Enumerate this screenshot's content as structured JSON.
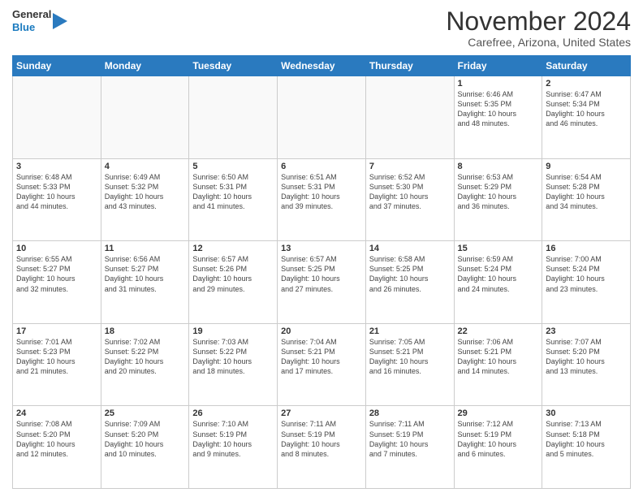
{
  "logo": {
    "line1": "General",
    "line2": "Blue"
  },
  "title": "November 2024",
  "location": "Carefree, Arizona, United States",
  "weekdays": [
    "Sunday",
    "Monday",
    "Tuesday",
    "Wednesday",
    "Thursday",
    "Friday",
    "Saturday"
  ],
  "weeks": [
    [
      {
        "day": "",
        "info": ""
      },
      {
        "day": "",
        "info": ""
      },
      {
        "day": "",
        "info": ""
      },
      {
        "day": "",
        "info": ""
      },
      {
        "day": "",
        "info": ""
      },
      {
        "day": "1",
        "info": "Sunrise: 6:46 AM\nSunset: 5:35 PM\nDaylight: 10 hours\nand 48 minutes."
      },
      {
        "day": "2",
        "info": "Sunrise: 6:47 AM\nSunset: 5:34 PM\nDaylight: 10 hours\nand 46 minutes."
      }
    ],
    [
      {
        "day": "3",
        "info": "Sunrise: 6:48 AM\nSunset: 5:33 PM\nDaylight: 10 hours\nand 44 minutes."
      },
      {
        "day": "4",
        "info": "Sunrise: 6:49 AM\nSunset: 5:32 PM\nDaylight: 10 hours\nand 43 minutes."
      },
      {
        "day": "5",
        "info": "Sunrise: 6:50 AM\nSunset: 5:31 PM\nDaylight: 10 hours\nand 41 minutes."
      },
      {
        "day": "6",
        "info": "Sunrise: 6:51 AM\nSunset: 5:31 PM\nDaylight: 10 hours\nand 39 minutes."
      },
      {
        "day": "7",
        "info": "Sunrise: 6:52 AM\nSunset: 5:30 PM\nDaylight: 10 hours\nand 37 minutes."
      },
      {
        "day": "8",
        "info": "Sunrise: 6:53 AM\nSunset: 5:29 PM\nDaylight: 10 hours\nand 36 minutes."
      },
      {
        "day": "9",
        "info": "Sunrise: 6:54 AM\nSunset: 5:28 PM\nDaylight: 10 hours\nand 34 minutes."
      }
    ],
    [
      {
        "day": "10",
        "info": "Sunrise: 6:55 AM\nSunset: 5:27 PM\nDaylight: 10 hours\nand 32 minutes."
      },
      {
        "day": "11",
        "info": "Sunrise: 6:56 AM\nSunset: 5:27 PM\nDaylight: 10 hours\nand 31 minutes."
      },
      {
        "day": "12",
        "info": "Sunrise: 6:57 AM\nSunset: 5:26 PM\nDaylight: 10 hours\nand 29 minutes."
      },
      {
        "day": "13",
        "info": "Sunrise: 6:57 AM\nSunset: 5:25 PM\nDaylight: 10 hours\nand 27 minutes."
      },
      {
        "day": "14",
        "info": "Sunrise: 6:58 AM\nSunset: 5:25 PM\nDaylight: 10 hours\nand 26 minutes."
      },
      {
        "day": "15",
        "info": "Sunrise: 6:59 AM\nSunset: 5:24 PM\nDaylight: 10 hours\nand 24 minutes."
      },
      {
        "day": "16",
        "info": "Sunrise: 7:00 AM\nSunset: 5:24 PM\nDaylight: 10 hours\nand 23 minutes."
      }
    ],
    [
      {
        "day": "17",
        "info": "Sunrise: 7:01 AM\nSunset: 5:23 PM\nDaylight: 10 hours\nand 21 minutes."
      },
      {
        "day": "18",
        "info": "Sunrise: 7:02 AM\nSunset: 5:22 PM\nDaylight: 10 hours\nand 20 minutes."
      },
      {
        "day": "19",
        "info": "Sunrise: 7:03 AM\nSunset: 5:22 PM\nDaylight: 10 hours\nand 18 minutes."
      },
      {
        "day": "20",
        "info": "Sunrise: 7:04 AM\nSunset: 5:21 PM\nDaylight: 10 hours\nand 17 minutes."
      },
      {
        "day": "21",
        "info": "Sunrise: 7:05 AM\nSunset: 5:21 PM\nDaylight: 10 hours\nand 16 minutes."
      },
      {
        "day": "22",
        "info": "Sunrise: 7:06 AM\nSunset: 5:21 PM\nDaylight: 10 hours\nand 14 minutes."
      },
      {
        "day": "23",
        "info": "Sunrise: 7:07 AM\nSunset: 5:20 PM\nDaylight: 10 hours\nand 13 minutes."
      }
    ],
    [
      {
        "day": "24",
        "info": "Sunrise: 7:08 AM\nSunset: 5:20 PM\nDaylight: 10 hours\nand 12 minutes."
      },
      {
        "day": "25",
        "info": "Sunrise: 7:09 AM\nSunset: 5:20 PM\nDaylight: 10 hours\nand 10 minutes."
      },
      {
        "day": "26",
        "info": "Sunrise: 7:10 AM\nSunset: 5:19 PM\nDaylight: 10 hours\nand 9 minutes."
      },
      {
        "day": "27",
        "info": "Sunrise: 7:11 AM\nSunset: 5:19 PM\nDaylight: 10 hours\nand 8 minutes."
      },
      {
        "day": "28",
        "info": "Sunrise: 7:11 AM\nSunset: 5:19 PM\nDaylight: 10 hours\nand 7 minutes."
      },
      {
        "day": "29",
        "info": "Sunrise: 7:12 AM\nSunset: 5:19 PM\nDaylight: 10 hours\nand 6 minutes."
      },
      {
        "day": "30",
        "info": "Sunrise: 7:13 AM\nSunset: 5:18 PM\nDaylight: 10 hours\nand 5 minutes."
      }
    ]
  ]
}
